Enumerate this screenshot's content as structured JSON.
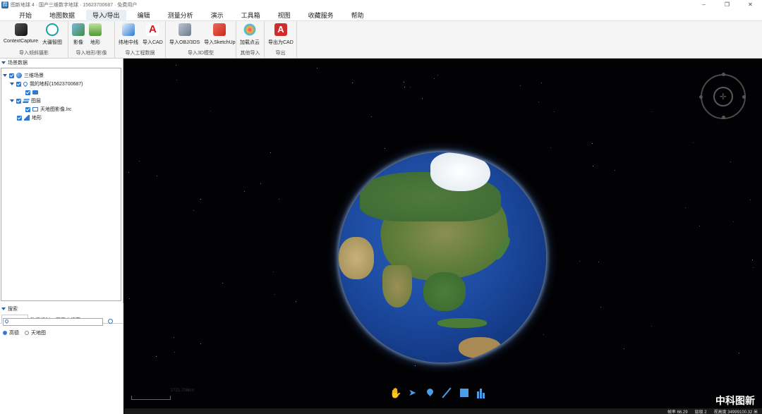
{
  "window": {
    "title": "图新地球 4 · 国产三维数字地球 · 15623700687 · 免费用户",
    "controls": [
      "–",
      "❐",
      "✕"
    ]
  },
  "menu": [
    {
      "label": "开始"
    },
    {
      "label": "地图数据"
    },
    {
      "label": "导入/导出",
      "active": true
    },
    {
      "label": "编辑"
    },
    {
      "label": "测量分析"
    },
    {
      "label": "演示"
    },
    {
      "label": "工具箱"
    },
    {
      "label": "视图"
    },
    {
      "label": "收藏服务"
    },
    {
      "label": "帮助"
    }
  ],
  "ribbon": {
    "groups": [
      {
        "label": "导入倾斜摄影",
        "buttons": [
          "ContextCapture",
          "大疆智图"
        ]
      },
      {
        "label": "导入地形/影像",
        "buttons": [
          "影像",
          "地形"
        ]
      },
      {
        "label": "导入工程数据",
        "buttons": [
          "纬地中线",
          "导入CAD"
        ]
      },
      {
        "label": "导入3D模型",
        "buttons": [
          "导入OBJ/3DS",
          "导入SketchUp"
        ]
      },
      {
        "label": "其他导入",
        "buttons": [
          "加载点云"
        ]
      },
      {
        "label": "导出",
        "buttons": [
          "导出为CAD"
        ]
      }
    ]
  },
  "scene_panel": {
    "header": "场景数据",
    "tree": [
      {
        "label": "三维场景",
        "icon": "globe-icon"
      },
      {
        "label": "我的地标(15623700687)",
        "icon": "placemark-icon"
      },
      {
        "label": "",
        "icon": "folder-icon"
      },
      {
        "label": "图层",
        "icon": "layers-icon"
      },
      {
        "label": "天地图影像.lrc",
        "icon": "monitor-icon"
      },
      {
        "label": "地形",
        "icon": "terrain-icon"
      }
    ]
  },
  "search_panel": {
    "header": "搜索",
    "tabs": [
      "地名搜索",
      "路径规划",
      "图层内搜索"
    ],
    "input_value": "",
    "options": [
      "高德",
      "天地图"
    ],
    "selected_option": "高德"
  },
  "viewport": {
    "scale_text": "2721.706km",
    "brand": "中科图新",
    "tools": [
      "hand-icon",
      "pointer-icon",
      "pin-icon",
      "line-icon",
      "polygon-icon",
      "chart-icon"
    ]
  },
  "status": {
    "items": [
      "帧率 66.29",
      "层级 2",
      "视高度 34999100.32 米"
    ]
  },
  "colors": {
    "accent": "#2f7ad0",
    "space": "#020204",
    "ocean": "#1c4aa0"
  }
}
